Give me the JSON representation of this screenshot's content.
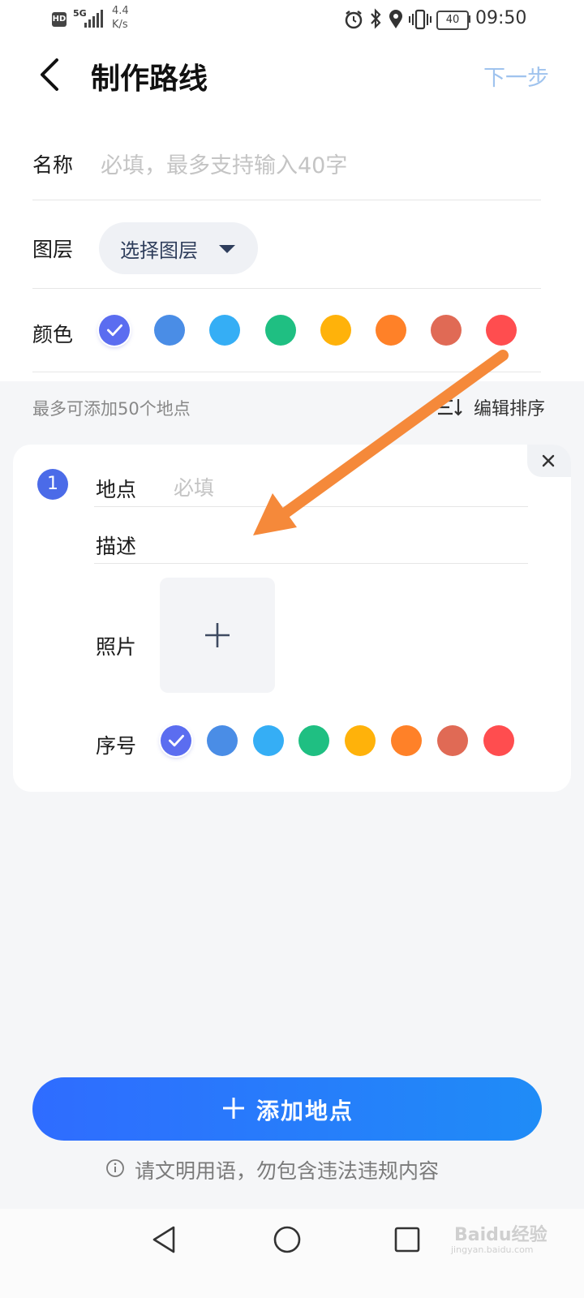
{
  "status_bar": {
    "network_badge": "HD",
    "signal_type": "5G",
    "speed_value": "4.4",
    "speed_unit": "K/s",
    "battery": "40",
    "time": "09:50",
    "icons": [
      "alarm-icon",
      "bluetooth-icon",
      "location-icon",
      "vibrate-icon",
      "battery-icon"
    ]
  },
  "header": {
    "title": "制作路线",
    "next_label": "下一步"
  },
  "form": {
    "name_label": "名称",
    "name_placeholder": "必填，最多支持输入40字",
    "layer_label": "图层",
    "layer_button": "选择图层",
    "color_label": "颜色",
    "colors": [
      "#5b6df0",
      "#4a8de6",
      "#35aef5",
      "#1fbf82",
      "#ffb20a",
      "#ff8128",
      "#e06a55",
      "#ff4d4f"
    ],
    "selected_color_index": 0
  },
  "places": {
    "limit_hint": "最多可添加50个地点",
    "sort_label": "编辑排序"
  },
  "place_card": {
    "index": "1",
    "location_label": "地点",
    "location_placeholder": "必填",
    "desc_label": "描述",
    "photo_label": "照片",
    "order_label": "序号",
    "selected_order_index": 0
  },
  "bottom": {
    "add_label": "添加地点",
    "notice": "请文明用语，勿包含违法违规内容"
  },
  "watermark": {
    "brand": "Baidu经验",
    "url": "jingyan.baidu.com"
  },
  "annotation_arrow_color": "#f5893a"
}
